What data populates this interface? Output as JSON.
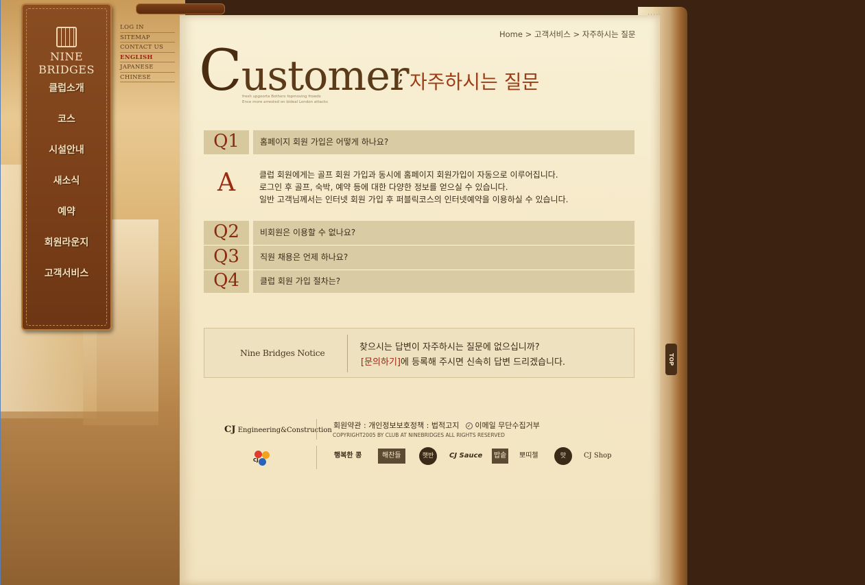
{
  "brand": {
    "logo_text": "NINE BRIDGES"
  },
  "main_menu": [
    {
      "label": "클럽소개"
    },
    {
      "label": "코스"
    },
    {
      "label": "시설안내"
    },
    {
      "label": "새소식"
    },
    {
      "label": "예약"
    },
    {
      "label": "회원라운지"
    },
    {
      "label": "고객서비스"
    }
  ],
  "top_links": [
    {
      "label": "LOG IN"
    },
    {
      "label": "SITEMAP"
    },
    {
      "label": "CONTACT US"
    },
    {
      "label": "ENGLISH",
      "active": true
    },
    {
      "label": "JAPANESE"
    },
    {
      "label": "CHINESE"
    }
  ],
  "breadcrumb": {
    "text": "Home > 고객서비스 > 자주하시는 질문"
  },
  "title": {
    "cap": "C",
    "rest": "ustomer",
    "separator": ";",
    "korean": "자주하시는 질문",
    "sub1": "fresh upgoorta Bothers fopmoving frowds",
    "sub2": "Ence more arrested on bideal London attacks"
  },
  "faq": [
    {
      "label": "Q1",
      "question": "홈페이지 회원 가입은 어떻게 하나요?"
    },
    {
      "label": "Q2",
      "question": "비회원은 이용할 수 없나요?"
    },
    {
      "label": "Q3",
      "question": "직원 채용은 언제 하나요?"
    },
    {
      "label": "Q4",
      "question": "클럽 회원 가입 절차는?"
    }
  ],
  "answer": {
    "label": "A",
    "line1": "클럽 회원에게는 골프 회원 가입과 동시에 홈페이지 회원가입이 자동으로 이루어집니다.",
    "line2": "로그인 후 골프, 숙박, 예약 등에 대한 다양한 정보를 얻으실 수 있습니다.",
    "line3": "일반 고객님께서는 인터넷 회원 가입 후 퍼블릭코스의 인터넷예약을 이용하실 수 있습니다."
  },
  "notice": {
    "title": "Nine Bridges Notice",
    "line1": "찾으시는 답변이 자주하시는 질문에 없으십니까?",
    "link": "[문의하기]",
    "line2_rest": "에 등록해 주시면 신속히 답변 드리겠습니다."
  },
  "footer": {
    "cj_eng_prefix": "CJ",
    "cj_eng_rest": "Engineering&Construction",
    "cj_logo_text": "CJ",
    "links": "회원약관 : 개인정보보호정책 : 법적고지",
    "email_policy": "이메일 무단수집거부",
    "copyright": "COPYRIGHT2005 BY CLUB AT NINEBRIDGES ALL RIGHTS RESERVED",
    "brands": [
      "행복한 콩",
      "해찬들",
      "햇반",
      "CJ Sauce",
      "밥솥",
      "뽀띠첼",
      "맛",
      "CJ Shop"
    ]
  },
  "top_button": {
    "label": "TOP"
  }
}
